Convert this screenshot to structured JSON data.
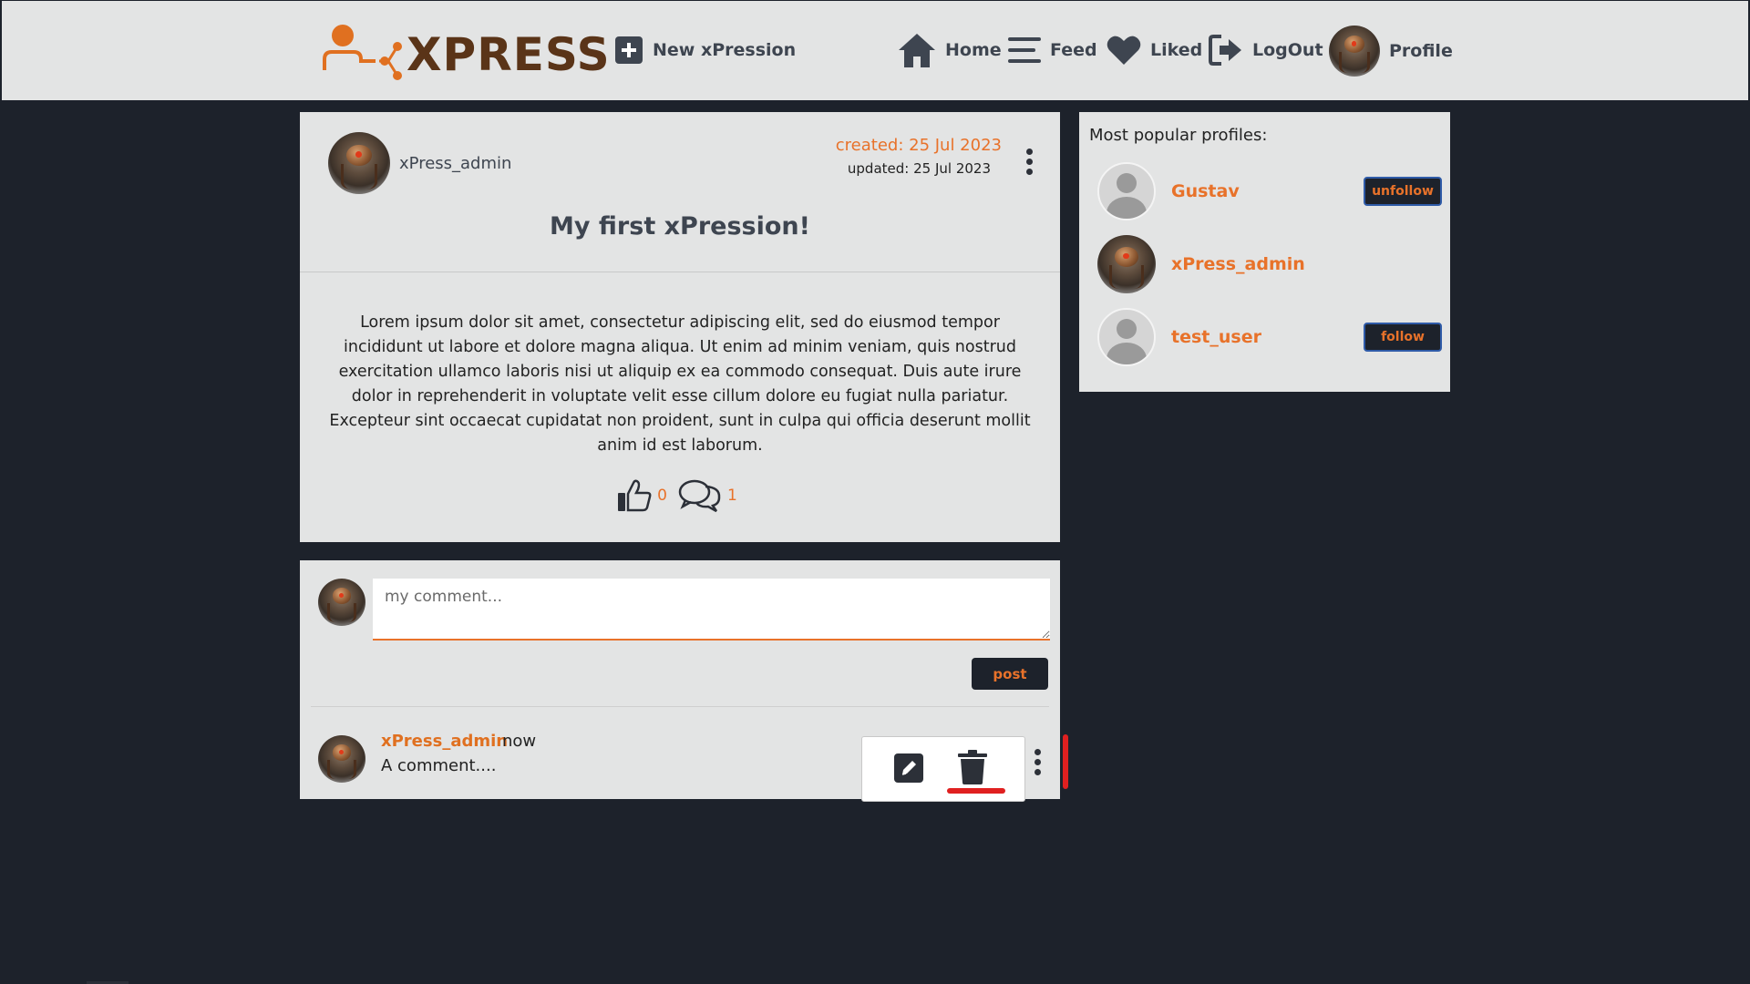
{
  "navbar": {
    "logo_text": "XPRESS",
    "new_label": "New xPression",
    "home_label": "Home",
    "feed_label": "Feed",
    "liked_label": "Liked",
    "logout_label": "LogOut",
    "profile_label": "Profile"
  },
  "post": {
    "author": "xPress_admin",
    "created": "created: 25 Jul 2023",
    "updated": "updated: 25 Jul 2023",
    "title": "My first xPression!",
    "body": "Lorem ipsum dolor sit amet, consectetur adipiscing elit, sed do eiusmod tempor incididunt ut labore et dolore magna aliqua. Ut enim ad minim veniam, quis nostrud exercitation ullamco laboris nisi ut aliquip ex ea commodo consequat. Duis aute irure dolor in reprehenderit in voluptate velit esse cillum dolore eu fugiat nulla pariatur. Excepteur sint occaecat cupidatat non proident, sunt in culpa qui officia deserunt mollit anim id est laborum.",
    "likes": "0",
    "comments": "1"
  },
  "comment_form": {
    "placeholder": "my comment...",
    "post_label": "post"
  },
  "comments": [
    {
      "author": "xPress_admin",
      "time": "now",
      "text": "A comment...."
    }
  ],
  "sidebar": {
    "title": "Most popular profiles:",
    "profiles": [
      {
        "name": "Gustav",
        "button": "unfollow"
      },
      {
        "name": "xPress_admin",
        "button": ""
      },
      {
        "name": "test_user",
        "button": "follow"
      }
    ]
  },
  "colors": {
    "accent": "#e8722a",
    "dark": "#1d222b",
    "card": "#e3e4e4",
    "danger": "#e02020"
  },
  "icons": {
    "new": "plus-square-icon",
    "home": "home-icon",
    "feed": "menu-lines-icon",
    "liked": "heart-icon",
    "logout": "logout-icon",
    "like": "thumbs-up-icon",
    "comment": "comments-icon",
    "edit": "pencil-icon",
    "delete": "trash-icon"
  }
}
